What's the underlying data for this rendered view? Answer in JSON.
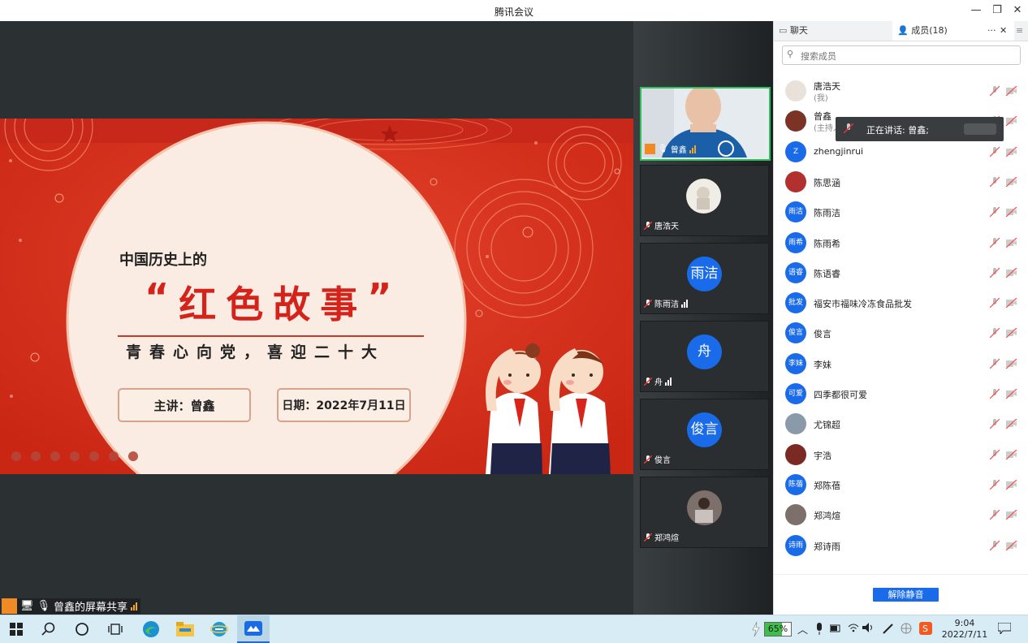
{
  "window": {
    "title": "腾讯会议",
    "minimize": "—",
    "restore": "❐",
    "close": "✕"
  },
  "slide": {
    "subtitle": "中国历史上的",
    "quote_open": "“",
    "headline": "红色故事",
    "quote_close": "”",
    "slogan": "青春心向党，喜迎二十大",
    "presenter": "主讲：曾鑫",
    "date": "日期：2022年7月11日"
  },
  "video_tiles": [
    {
      "name": "曾鑫",
      "type": "camera"
    },
    {
      "name": "唐浩天",
      "type": "avatar"
    },
    {
      "name": "陈雨洁",
      "initials": "雨洁",
      "type": "initials"
    },
    {
      "name": "舟",
      "initials": "舟",
      "type": "initials"
    },
    {
      "name": "俊言",
      "initials": "俊言",
      "type": "initials"
    },
    {
      "name": "郑鸿煊",
      "type": "avatar"
    }
  ],
  "share_label": "曾鑫的屏幕共享",
  "panel": {
    "tab_chat": "聊天",
    "tab_members": "成员(18)",
    "more": "···",
    "close": "✕",
    "menu": "≡",
    "search_placeholder": "搜索成员",
    "speaking": "正在讲话: 曾鑫;",
    "unmute_all": "解除静音",
    "members": [
      {
        "name": "唐浩天",
        "sub": "(我)",
        "avatar": "photo",
        "color": "#e8e2da"
      },
      {
        "name": "曾鑫",
        "sub": "(主持人)",
        "avatar": "photo",
        "color": "#7b3326"
      },
      {
        "name": "zhengjinrui",
        "initials": "Z",
        "color": "#1a6bea"
      },
      {
        "name": "陈思涵",
        "avatar": "photo",
        "color": "#b23030"
      },
      {
        "name": "陈雨洁",
        "initials": "雨洁",
        "color": "#1a6bea"
      },
      {
        "name": "陈雨希",
        "initials": "雨希",
        "color": "#1a6bea"
      },
      {
        "name": "陈语睿",
        "initials": "语睿",
        "color": "#1a6bea"
      },
      {
        "name": "福安市福味冷冻食品批发",
        "initials": "批发",
        "color": "#1a6bea"
      },
      {
        "name": "俊言",
        "initials": "俊言",
        "color": "#1a6bea"
      },
      {
        "name": "李妹",
        "initials": "李妹",
        "color": "#1a6bea"
      },
      {
        "name": "四季都很可爱",
        "initials": "可爱",
        "color": "#1a6bea"
      },
      {
        "name": "尤锦超",
        "avatar": "photo",
        "color": "#8a9aa8"
      },
      {
        "name": "宇浩",
        "avatar": "photo",
        "color": "#7a2a22"
      },
      {
        "name": "郑陈蓓",
        "initials": "陈蓓",
        "color": "#1a6bea"
      },
      {
        "name": "郑鸿煊",
        "avatar": "photo",
        "color": "#7d6f6a"
      },
      {
        "name": "郑诗雨",
        "initials": "诗雨",
        "color": "#1a6bea"
      }
    ]
  },
  "taskbar": {
    "battery": "65%",
    "time": "9:04",
    "date": "2022/7/11"
  }
}
